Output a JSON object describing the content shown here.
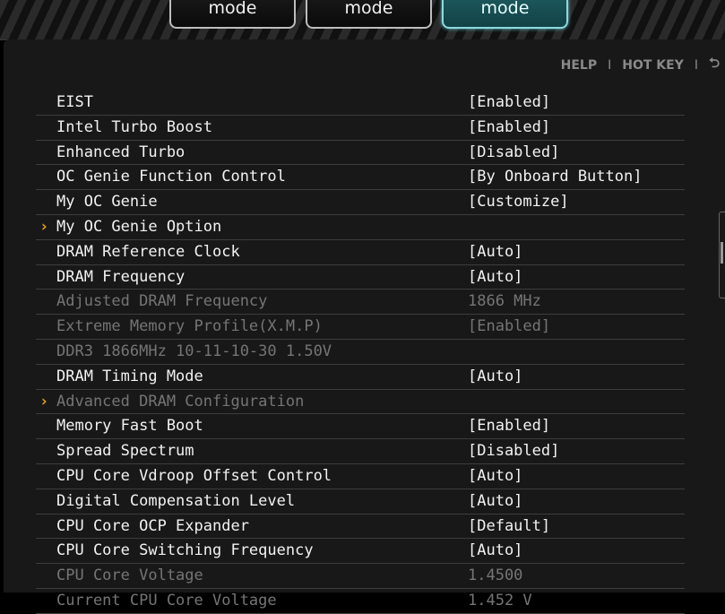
{
  "tabs": [
    {
      "label": "mode",
      "active": false
    },
    {
      "label": "mode",
      "active": false
    },
    {
      "label": "mode",
      "active": true
    }
  ],
  "toplinks": {
    "help": "HELP",
    "hotkey": "HOT KEY",
    "sep": "I"
  },
  "colors": {
    "accent_arrow": "#e2a11a",
    "active_tab": "#1f5e63",
    "dim_text": "#757575"
  },
  "settings": [
    {
      "label": "EIST",
      "value": "[Enabled]"
    },
    {
      "label": "Intel Turbo Boost",
      "value": "[Enabled]"
    },
    {
      "label": "Enhanced Turbo",
      "value": "[Disabled]"
    },
    {
      "label": "OC Genie Function Control",
      "value": "[By Onboard Button]"
    },
    {
      "label": "My OC Genie",
      "value": "[Customize]"
    },
    {
      "label": "My OC Genie Option",
      "value": "",
      "submenu": true
    },
    {
      "label": "DRAM Reference Clock",
      "value": "[Auto]"
    },
    {
      "label": "DRAM Frequency",
      "value": "[Auto]"
    },
    {
      "label": "Adjusted DRAM Frequency",
      "value": "1866 MHz",
      "dim": true
    },
    {
      "label": "Extreme Memory Profile(X.M.P)",
      "value": "[Enabled]",
      "dim": true
    },
    {
      "label": "DDR3 1866MHz 10-11-10-30 1.50V",
      "value": "",
      "dim": true
    },
    {
      "label": "DRAM Timing Mode",
      "value": "[Auto]"
    },
    {
      "label": "Advanced DRAM Configuration",
      "value": "",
      "submenu": true,
      "dim": true
    },
    {
      "label": "Memory Fast Boot",
      "value": "[Enabled]"
    },
    {
      "label": "Spread Spectrum",
      "value": "[Disabled]"
    },
    {
      "label": "CPU Core Vdroop Offset Control",
      "value": "[Auto]"
    },
    {
      "label": "Digital Compensation Level",
      "value": "[Auto]"
    },
    {
      "label": "CPU Core OCP Expander",
      "value": "[Default]"
    },
    {
      "label": "CPU Core Switching Frequency",
      "value": "[Auto]"
    },
    {
      "label": "CPU Core Voltage",
      "value": "1.4500",
      "dim": true
    },
    {
      "label": "Current CPU Core Voltage",
      "value": "1.452 V",
      "dim": true
    }
  ]
}
